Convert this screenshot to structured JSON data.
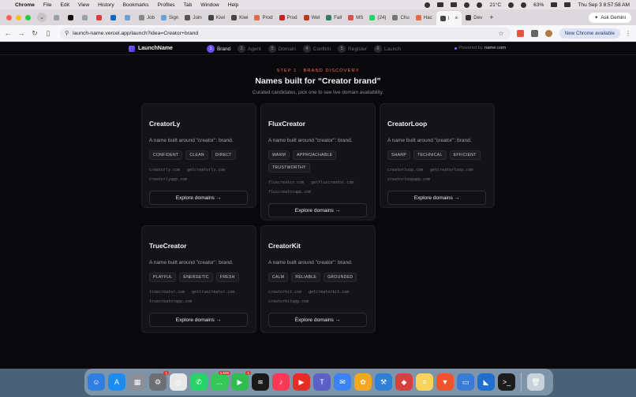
{
  "menubar": {
    "app": "Chrome",
    "items": [
      "File",
      "Edit",
      "View",
      "History",
      "Bookmarks",
      "Profiles",
      "Tab",
      "Window",
      "Help"
    ],
    "weather": "21°C",
    "battery": "63%",
    "datetime": "Thu Sep 3  8:57:58 AM"
  },
  "tabs": {
    "items": [
      {
        "label": "",
        "color": "#9aa0a6"
      },
      {
        "label": "",
        "color": "#111111"
      },
      {
        "label": "",
        "color": "#9aa0a6"
      },
      {
        "label": "",
        "color": "#e23a3a"
      },
      {
        "label": "",
        "color": "#0a66c2"
      },
      {
        "label": "",
        "color": "#6aa0d8"
      },
      {
        "label": "Job",
        "color": "#888888"
      },
      {
        "label": "Sign",
        "color": "#6aa0d8"
      },
      {
        "label": "Join",
        "color": "#555555"
      },
      {
        "label": "Kiwi",
        "color": "#444444"
      },
      {
        "label": "Kiwi",
        "color": "#444444"
      },
      {
        "label": "Prod",
        "color": "#e26a4d"
      },
      {
        "label": "Prod",
        "color": "#c5221f"
      },
      {
        "label": "Wel",
        "color": "#b83a1a"
      },
      {
        "label": "Fall",
        "color": "#2e7d6b"
      },
      {
        "label": "MS",
        "color": "#d9534f"
      },
      {
        "label": "(24)",
        "color": "#25d366"
      },
      {
        "label": "Chu",
        "color": "#777777"
      },
      {
        "label": "Hac",
        "color": "#e26a4d"
      },
      {
        "label": "l",
        "color": "#444444",
        "active": true
      },
      {
        "label": "Dev",
        "color": "#333333"
      }
    ],
    "ask_gemini": "Ask Gemini"
  },
  "toolbar": {
    "url": "launch-name.vercel.app/launch?idea=Creator+brand",
    "new_chrome": "New Chrome available"
  },
  "app": {
    "brand": "LaunchName",
    "steps": [
      {
        "num": "1",
        "label": "Brand",
        "active": true
      },
      {
        "num": "2",
        "label": "Agent"
      },
      {
        "num": "3",
        "label": "Domain"
      },
      {
        "num": "4",
        "label": "Confirm"
      },
      {
        "num": "5",
        "label": "Register"
      },
      {
        "num": "6",
        "label": "Launch"
      }
    ],
    "powered_prefix": "Powered by",
    "powered_name": "name.com",
    "eyebrow": "STEP 1 · BRAND DISCOVERY",
    "headline": "Names built for “Creator brand”",
    "sub": "Curated candidates, pick one to see live domain availability.",
    "cards": [
      {
        "name": "CreatorLy",
        "desc": "A name built around \"creator\": brand.",
        "tags": [
          "CONFIDENT",
          "CLEAN",
          "DIRECT"
        ],
        "domains": [
          "creatorly.com",
          "getcreatorly.com",
          "creatorlyapp.com"
        ],
        "cta": "Explore domains →"
      },
      {
        "name": "FluxCreator",
        "desc": "A name built around \"creator\": brand.",
        "tags": [
          "WARM",
          "APPROACHABLE",
          "TRUSTWORTHY"
        ],
        "domains": [
          "fluxcreator.com",
          "getfluxcreator.com",
          "fluxcreatorapp.com"
        ],
        "cta": "Explore domains →"
      },
      {
        "name": "CreatorLoop",
        "desc": "A name built around \"creator\": brand.",
        "tags": [
          "SHARP",
          "TECHNICAL",
          "EFFICIENT"
        ],
        "domains": [
          "creatorloop.com",
          "getcreatorloop.com",
          "creatorloopapp.com"
        ],
        "cta": "Explore domains →"
      },
      {
        "name": "TrueCreator",
        "desc": "A name built around \"creator\": brand.",
        "tags": [
          "PLAYFUL",
          "ENERGETIC",
          "FRESH"
        ],
        "domains": [
          "truecreator.com",
          "gettruecreator.com",
          "truecreatorapp.com"
        ],
        "cta": "Explore domains →"
      },
      {
        "name": "CreatorKit",
        "desc": "A name built around \"creator\": brand.",
        "tags": [
          "CALM",
          "RELIABLE",
          "GROUNDED"
        ],
        "domains": [
          "creatorkit.com",
          "getcreatorkit.com",
          "creatorkitapp.com"
        ],
        "cta": "Explore domains →"
      }
    ]
  },
  "dock": {
    "apps": [
      {
        "name": "finder-icon",
        "color": "#2f7fe0",
        "glyph": "☺"
      },
      {
        "name": "app-store-icon",
        "color": "#1d8cf0",
        "glyph": "A"
      },
      {
        "name": "launchpad-icon",
        "color": "#8a8f99",
        "glyph": "▦"
      },
      {
        "name": "system-settings-icon",
        "color": "#6d6f75",
        "glyph": "⚙",
        "badge": "1"
      },
      {
        "name": "chrome-icon",
        "color": "#e8e8e8",
        "glyph": "◎"
      },
      {
        "name": "whatsapp-icon",
        "color": "#25d366",
        "glyph": "✆"
      },
      {
        "name": "messages-icon",
        "color": "#35c759",
        "glyph": "…",
        "badge": "1,526"
      },
      {
        "name": "facetime-icon",
        "color": "#2ebd4e",
        "glyph": "▶",
        "badge": "1"
      },
      {
        "name": "spotify-icon",
        "color": "#1a1a1a",
        "glyph": "≋"
      },
      {
        "name": "music-icon",
        "color": "#fa3a55",
        "glyph": "♪"
      },
      {
        "name": "youtube-icon",
        "color": "#e52d27",
        "glyph": "▶"
      },
      {
        "name": "teams-icon",
        "color": "#5b5fc7",
        "glyph": "T"
      },
      {
        "name": "mail-icon",
        "color": "#3b82f6",
        "glyph": "✉"
      },
      {
        "name": "photos-icon",
        "color": "#f5a623",
        "glyph": "✿"
      },
      {
        "name": "xcode-icon",
        "color": "#2d7fd8",
        "glyph": "⚒"
      },
      {
        "name": "red-app-icon",
        "color": "#d84040",
        "glyph": "◆"
      },
      {
        "name": "notes-icon",
        "color": "#f7d35a",
        "glyph": "≡"
      },
      {
        "name": "brave-icon",
        "color": "#f0542d",
        "glyph": "▼"
      },
      {
        "name": "remote-desktop-icon",
        "color": "#3a7bd5",
        "glyph": "▭"
      },
      {
        "name": "vscode-icon",
        "color": "#1f6fd1",
        "glyph": "◣"
      },
      {
        "name": "terminal-icon",
        "color": "#1c1c1c",
        "glyph": ">_"
      },
      {
        "name": "trash-icon",
        "color": "#c9d2da",
        "glyph": "🗑"
      }
    ]
  }
}
